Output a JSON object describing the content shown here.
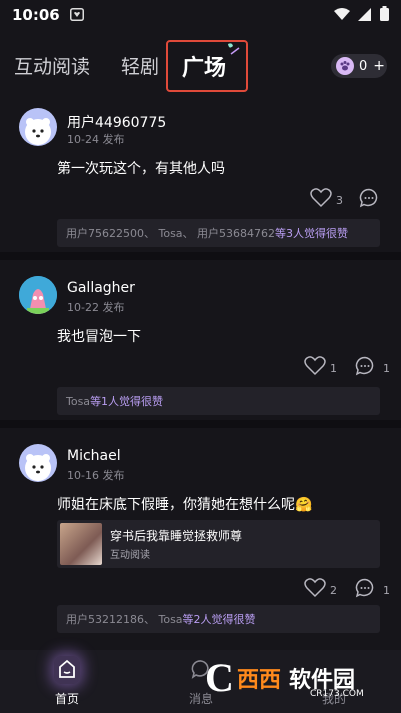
{
  "status_bar": {
    "time": "10:06"
  },
  "top_nav": {
    "tabs": [
      {
        "label": "互动阅读"
      },
      {
        "label": "轻剧"
      },
      {
        "label": "广场",
        "selected": true
      }
    ],
    "coins": {
      "count": "0",
      "plus": "+"
    }
  },
  "posts": [
    {
      "username": "用户44960775",
      "date": "10-24 发布",
      "content": "第一次玩这个，有其他人吗",
      "like_count": "3",
      "comment_count": "",
      "liked_by": "用户75622500、 Tosa、 用户53684762 ",
      "liked_summary": "等3人觉得很赞"
    },
    {
      "username": "Gallagher",
      "date": "10-22 发布",
      "content": "我也冒泡一下",
      "like_count": "1",
      "comment_count": "1",
      "liked_by": "Tosa ",
      "liked_summary": "等1人觉得很赞"
    },
    {
      "username": "Michael",
      "date": "10-16 发布",
      "content": "师姐在床底下假睡，你猜她在想什么呢",
      "emoji": "🤗",
      "book": {
        "title": "穿书后我靠睡觉拯救师尊",
        "type": "互动阅读"
      },
      "like_count": "2",
      "comment_count": "1",
      "liked_by": "用户53212186、 Tosa ",
      "liked_summary": "等2人觉得很赞"
    }
  ],
  "tab_bar": {
    "items": [
      {
        "label": "首页",
        "active": true
      },
      {
        "label": "消息"
      },
      {
        "label": "我的"
      }
    ]
  },
  "watermark": {
    "brand": "西西",
    "suffix": "软件园",
    "url": "CR173.COM"
  },
  "colors": {
    "accent": "#b99ef2",
    "highlight_box": "#e04a3a",
    "background": "#16151a"
  }
}
